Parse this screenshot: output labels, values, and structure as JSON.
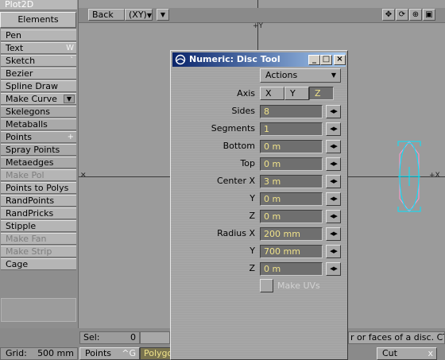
{
  "left_panel": {
    "top_tab": "Plot2D",
    "category": "Elements",
    "tools": [
      {
        "label": "Pen",
        "shortcut": "",
        "dim": false,
        "alt": false,
        "dropdown": false
      },
      {
        "label": "Text",
        "shortcut": "W",
        "dim": false,
        "alt": false,
        "dropdown": false
      },
      {
        "label": "Sketch",
        "shortcut": "`",
        "dim": false,
        "alt": false,
        "dropdown": false
      },
      {
        "label": "Bezier",
        "shortcut": "",
        "dim": false,
        "alt": false,
        "dropdown": false
      },
      {
        "label": "Spline Draw",
        "shortcut": "",
        "dim": false,
        "alt": false,
        "dropdown": false
      },
      {
        "label": "Make Curve",
        "shortcut": "",
        "dim": false,
        "alt": false,
        "dropdown": true
      },
      {
        "label": "Skelegons",
        "shortcut": "",
        "dim": false,
        "alt": true,
        "dropdown": false
      },
      {
        "label": "Metaballs",
        "shortcut": "",
        "dim": false,
        "alt": true,
        "dropdown": false
      },
      {
        "label": "Points",
        "shortcut": "+",
        "dim": false,
        "alt": true,
        "dropdown": false
      },
      {
        "label": "Spray Points",
        "shortcut": "",
        "dim": false,
        "alt": true,
        "dropdown": false
      },
      {
        "label": "Metaedges",
        "shortcut": "",
        "dim": false,
        "alt": true,
        "dropdown": false
      },
      {
        "label": "Make Pol",
        "shortcut": "",
        "dim": true,
        "alt": false,
        "dropdown": false
      },
      {
        "label": "Points to Polys",
        "shortcut": "",
        "dim": false,
        "alt": false,
        "dropdown": false
      },
      {
        "label": "RandPoints",
        "shortcut": "",
        "dim": false,
        "alt": false,
        "dropdown": false
      },
      {
        "label": "RandPricks",
        "shortcut": "",
        "dim": false,
        "alt": false,
        "dropdown": false
      },
      {
        "label": "Stipple",
        "shortcut": "",
        "dim": false,
        "alt": false,
        "dropdown": false
      },
      {
        "label": "Make Fan",
        "shortcut": "",
        "dim": true,
        "alt": false,
        "dropdown": false
      },
      {
        "label": "Make Strip",
        "shortcut": "",
        "dim": true,
        "alt": false,
        "dropdown": false
      },
      {
        "label": "Cage",
        "shortcut": "",
        "dim": false,
        "alt": false,
        "dropdown": false
      }
    ]
  },
  "viewport": {
    "view_button": "Back",
    "axes_button": "(XY)",
    "dropdown_arrow": "▼",
    "axis_marker_v": "+Y",
    "axis_marker_h": "+X"
  },
  "status_bar": {
    "sel_label": "Sel:",
    "sel_value": "0",
    "grid_label": "Grid:",
    "grid_value": "500 mm",
    "points_label": "Points",
    "points_shortcut": "^G",
    "polygons_label": "Polygo",
    "help_text": "r or faces of a disc. CTRL",
    "cut_label": "Cut",
    "cut_shortcut": "x"
  },
  "dialog": {
    "title": "Numeric: Disc Tool",
    "actions_label": "Actions",
    "axis_label": "Axis",
    "axis_options": [
      "X",
      "Y",
      "Z"
    ],
    "axis_selected": "Z",
    "fields": [
      {
        "label": "Sides",
        "value": "8"
      },
      {
        "label": "Segments",
        "value": "1"
      },
      {
        "label": "Bottom",
        "value": "0 m"
      },
      {
        "label": "Top",
        "value": "0 m"
      },
      {
        "label": "Center X",
        "value": "3 m"
      },
      {
        "label": "Y",
        "value": "0 m"
      },
      {
        "label": "Z",
        "value": "0 m"
      },
      {
        "label": "Radius X",
        "value": "200 mm"
      },
      {
        "label": "Y",
        "value": "700 mm"
      },
      {
        "label": "Z",
        "value": "0 m"
      }
    ],
    "make_uvs_label": "Make UVs",
    "minimize": "_",
    "maximize": "□",
    "close": "×"
  },
  "colors": {
    "title_gradient_start": "#0a246a",
    "title_gradient_end": "#a6caf0",
    "field_text": "#f0e38a",
    "disc_outline": "#00e5ff",
    "disc_edges": "#ff99cc"
  }
}
